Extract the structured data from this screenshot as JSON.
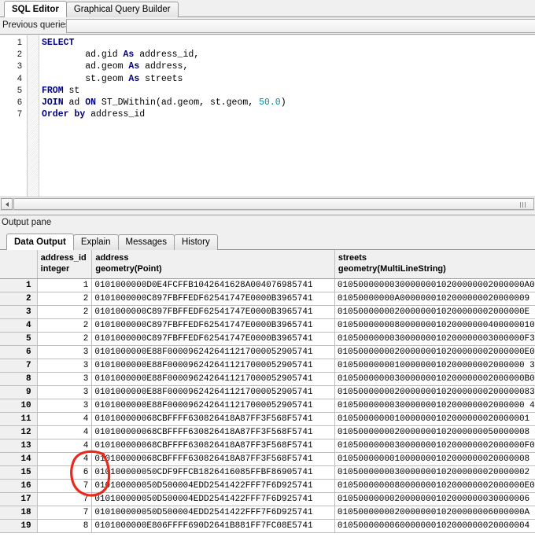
{
  "window": {
    "top_tabs": [
      {
        "label": "SQL Editor",
        "active": true
      },
      {
        "label": "Graphical Query Builder",
        "active": false
      }
    ]
  },
  "toolbar": {
    "previous_queries_label": "Previous queries",
    "previous_queries_value": ""
  },
  "editor": {
    "line_numbers": [
      "1",
      "2",
      "3",
      "4",
      "5",
      "6",
      "7"
    ],
    "lines": [
      "SELECT",
      "        ad.gid As address_id,",
      "        ad.geom As address,",
      "        st.geom As streets",
      "FROM st",
      "JOIN ad ON ST_DWithin(ad.geom, st.geom, 50.0)",
      "Order by address_id"
    ],
    "keywords": [
      "SELECT",
      "As",
      "FROM",
      "JOIN",
      "ON",
      "Order",
      "by"
    ],
    "number_literal": "50.0",
    "keyword_color": "#000080",
    "number_color": "#0090a0"
  },
  "output_pane": {
    "label": "Output pane",
    "tabs": [
      {
        "label": "Data Output",
        "active": true
      },
      {
        "label": "Explain",
        "active": false
      },
      {
        "label": "Messages",
        "active": false
      },
      {
        "label": "History",
        "active": false
      }
    ]
  },
  "grid": {
    "columns": [
      {
        "name": "",
        "type": ""
      },
      {
        "name": "address_id",
        "type": "integer"
      },
      {
        "name": "address",
        "type": "geometry(Point)"
      },
      {
        "name": "streets",
        "type": "geometry(MultiLineString)"
      }
    ],
    "rows": [
      {
        "n": "1",
        "address_id": "1",
        "address": "0101000000D0E4FCFFB1042641628A004076985741",
        "streets": "010500000003000000010200000002000000A0"
      },
      {
        "n": "2",
        "address_id": "2",
        "address": "0101000000C897FBFFEDF62541747E0000B3965741",
        "streets": "01050000000A0000000102000000020000009"
      },
      {
        "n": "3",
        "address_id": "2",
        "address": "0101000000C897FBFFEDF62541747E0000B3965741",
        "streets": "010500000002000000010200000002000000E"
      },
      {
        "n": "4",
        "address_id": "2",
        "address": "0101000000C897FBFFEDF62541747E0000B3965741",
        "streets": "01050000000800000001020000000400000010"
      },
      {
        "n": "5",
        "address_id": "2",
        "address": "0101000000C897FBFFEDF62541747E0000B3965741",
        "streets": "010500000003000000010200000003000000F3"
      },
      {
        "n": "6",
        "address_id": "3",
        "address": "0101000000E88F0000962426411217000052905741",
        "streets": "010500000002000000010200000002000000E0"
      },
      {
        "n": "7",
        "address_id": "3",
        "address": "0101000000E88F0000962426411217000052905741",
        "streets": "010500000001000000010200000002000000 3"
      },
      {
        "n": "8",
        "address_id": "3",
        "address": "0101000000E88F0000962426411217000052905741",
        "streets": "010500000003000000010200000002000000B0"
      },
      {
        "n": "9",
        "address_id": "3",
        "address": "0101000000E88F0000962426411217000052905741",
        "streets": "01050000000200000001020000000200000083"
      },
      {
        "n": "10",
        "address_id": "3",
        "address": "0101000000E88F0000962426411217000052905741",
        "streets": "010500000003000000010200000002000000 40"
      },
      {
        "n": "11",
        "address_id": "4",
        "address": "010100000068CBFFFF630826418A87FF3F568F5741",
        "streets": "0105000000010000000102000000020000001 3"
      },
      {
        "n": "12",
        "address_id": "4",
        "address": "010100000068CBFFFF630826418A87FF3F568F5741",
        "streets": "0105000000020000000102000000050000008 0"
      },
      {
        "n": "13",
        "address_id": "4",
        "address": "010100000068CBFFFF630826418A87FF3F568F5741",
        "streets": "010500000003000000010200000002000000F0"
      },
      {
        "n": "14",
        "address_id": "4",
        "address": "010100000068CBFFFF630826418A87FF3F568F5741",
        "streets": "0105000000010000000102000000020000008 0"
      },
      {
        "n": "15",
        "address_id": "6",
        "address": "010100000050CDF9FFCB1826416085FFBF86905741",
        "streets": "0105000000030000000102000000020000002 0"
      },
      {
        "n": "16",
        "address_id": "7",
        "address": "010100000050D500004EDD2541422FFF7F6D925741",
        "streets": "010500000008000000010200000002000000E0"
      },
      {
        "n": "17",
        "address_id": "7",
        "address": "010100000050D500004EDD2541422FFF7F6D925741",
        "streets": "0105000000020000000102000000030000006 0"
      },
      {
        "n": "18",
        "address_id": "7",
        "address": "010100000050D500004EDD2541422FFF7F6D925741",
        "streets": "010500000002000000010200000006000000A 0"
      },
      {
        "n": "19",
        "address_id": "8",
        "address": "0101000000E806FFFF690D2641B881FF7FC08E5741",
        "streets": "0105000000060000000102000000020000004 0"
      }
    ]
  },
  "annotation": {
    "shape": "red-ellipse",
    "color": "#e8291c",
    "target_rows": [
      "14",
      "15"
    ]
  }
}
